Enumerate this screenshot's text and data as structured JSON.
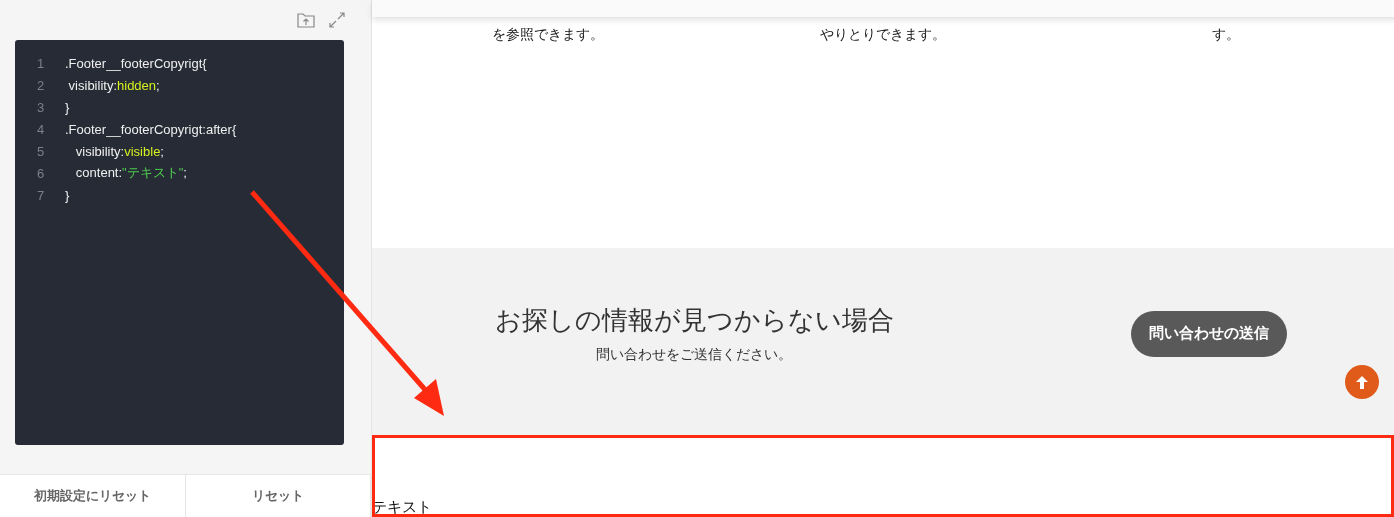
{
  "editor": {
    "lines": [
      {
        "number": "1",
        "tokens": [
          {
            "text": ".Footer__footerCopyrigt{",
            "kind": "plain"
          }
        ]
      },
      {
        "number": "2",
        "tokens": [
          {
            "text": " visibility:",
            "kind": "plain"
          },
          {
            "text": "hidden",
            "kind": "keyword"
          },
          {
            "text": ";",
            "kind": "plain"
          }
        ]
      },
      {
        "number": "3",
        "tokens": [
          {
            "text": "}",
            "kind": "plain"
          }
        ]
      },
      {
        "number": "4",
        "tokens": [
          {
            "text": ".Footer__footerCopyrigt:after{",
            "kind": "plain"
          }
        ]
      },
      {
        "number": "5",
        "tokens": [
          {
            "text": "   visibility:",
            "kind": "plain"
          },
          {
            "text": "visible",
            "kind": "keyword"
          },
          {
            "text": ";",
            "kind": "plain"
          }
        ]
      },
      {
        "number": "6",
        "tokens": [
          {
            "text": "   content:",
            "kind": "plain"
          },
          {
            "text": "\"テキスト\"",
            "kind": "string"
          },
          {
            "text": ";",
            "kind": "plain"
          }
        ]
      },
      {
        "number": "7",
        "tokens": [
          {
            "text": "}",
            "kind": "plain"
          }
        ]
      }
    ]
  },
  "bottom_buttons": [
    "初期設定にリセット",
    "リセット"
  ],
  "preview": {
    "feature_texts": [
      "を参照できます。",
      "やりとりできます。",
      "す。"
    ],
    "contact": {
      "heading": "お探しの情報が見つからない場合",
      "subtitle": "問い合わせをご送信ください。",
      "button": "問い合わせの送信"
    },
    "footer_text": "テキスト"
  }
}
